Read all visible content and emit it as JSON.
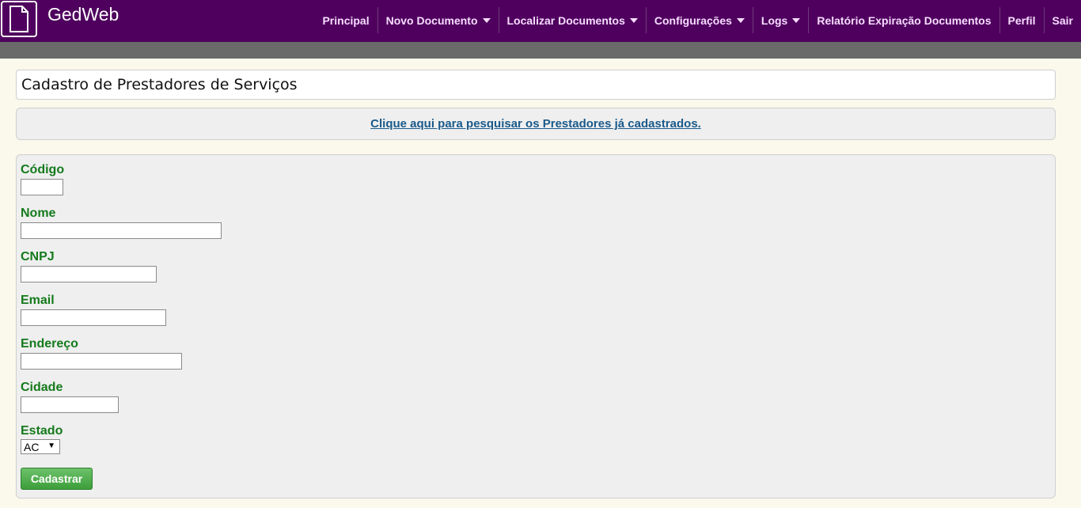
{
  "app": {
    "brand": "GedWeb"
  },
  "nav": {
    "items": [
      {
        "label": "Principal"
      },
      {
        "label": "Novo Documento"
      },
      {
        "label": "Localizar Documentos"
      },
      {
        "label": "Configurações"
      },
      {
        "label": "Logs"
      },
      {
        "label": "Relatório Expiração Documentos"
      },
      {
        "label": "Perfil"
      },
      {
        "label": "Sair"
      }
    ]
  },
  "page": {
    "title": "Cadastro de Prestadores de Serviços",
    "search_link": "Clique aqui para pesquisar os Prestadores já cadastrados."
  },
  "form": {
    "codigo": {
      "label": "Código",
      "value": ""
    },
    "nome": {
      "label": "Nome",
      "value": ""
    },
    "cnpj": {
      "label": "CNPJ",
      "value": ""
    },
    "email": {
      "label": "Email",
      "value": ""
    },
    "endereco": {
      "label": "Endereço",
      "value": ""
    },
    "cidade": {
      "label": "Cidade",
      "value": ""
    },
    "estado": {
      "label": "Estado",
      "selected": "AC"
    },
    "submit_label": "Cadastrar"
  },
  "colors": {
    "topbar": "#4f005e",
    "label_green": "#157a1c",
    "link_blue": "#1a5a8a",
    "button_green": "#4cae4a"
  }
}
